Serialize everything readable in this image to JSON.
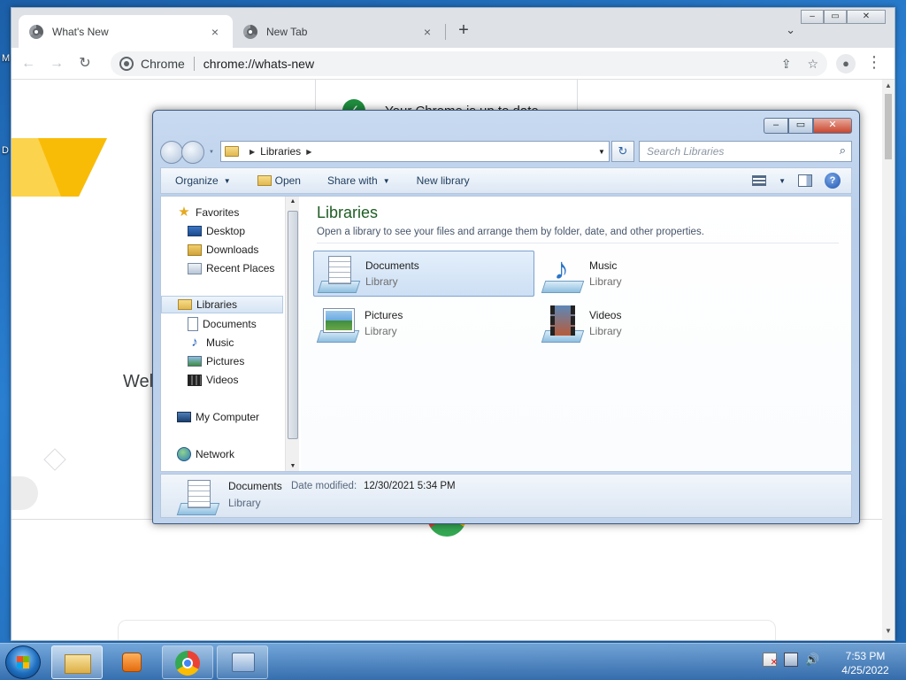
{
  "desktop": {
    "edge_label_1": "M",
    "edge_label_2": "D"
  },
  "chrome": {
    "tabs": [
      {
        "title": "What's New",
        "close": "×"
      },
      {
        "title": "New Tab",
        "close": "×"
      }
    ],
    "new_tab_glyph": "+",
    "tab_search_glyph": "⌄",
    "window_controls": {
      "minimize": "–",
      "maximize": "▭",
      "close": "✕"
    },
    "toolbar": {
      "back": "←",
      "forward": "→",
      "reload": "↻"
    },
    "omnibox": {
      "chip": "Chrome",
      "url": "chrome://whats-new",
      "share_glyph": "⇪",
      "star_glyph": "☆"
    },
    "profile_glyph": "●",
    "menu_glyph": "⋮",
    "page": {
      "up_to_date_text": "Your Chrome is up to date",
      "check_glyph": "✓",
      "welcome_fragment": "Wel"
    }
  },
  "explorer": {
    "controls": {
      "minimize": "–",
      "maximize": "▭",
      "close": "✕"
    },
    "address": {
      "crumb": "Libraries"
    },
    "search_placeholder": "Search Libraries",
    "search_glyph": "⌕",
    "refresh_glyph": "↻",
    "commands": {
      "organize": "Organize",
      "open": "Open",
      "share_with": "Share with",
      "new_library": "New library",
      "help": "?"
    },
    "nav": {
      "favorites": "Favorites",
      "desktop": "Desktop",
      "downloads": "Downloads",
      "recent_places": "Recent Places",
      "libraries": "Libraries",
      "documents": "Documents",
      "music": "Music",
      "pictures": "Pictures",
      "videos": "Videos",
      "my_computer": "My Computer",
      "network": "Network"
    },
    "content": {
      "title": "Libraries",
      "description": "Open a library to see your files and arrange them by folder, date, and other properties.",
      "items": [
        {
          "name": "Documents",
          "type": "Library",
          "icon": "documents-library-icon"
        },
        {
          "name": "Music",
          "type": "Library",
          "icon": "music-library-icon"
        },
        {
          "name": "Pictures",
          "type": "Library",
          "icon": "pictures-library-icon"
        },
        {
          "name": "Videos",
          "type": "Library",
          "icon": "videos-library-icon"
        }
      ]
    },
    "details": {
      "name": "Documents",
      "modified_label": "Date modified:",
      "modified_value": "12/30/2021 5:34 PM",
      "type": "Library"
    }
  },
  "taskbar": {
    "clock_time": "7:53 PM",
    "clock_date": "4/25/2022",
    "tray": {
      "volume_glyph": "🔊"
    }
  }
}
